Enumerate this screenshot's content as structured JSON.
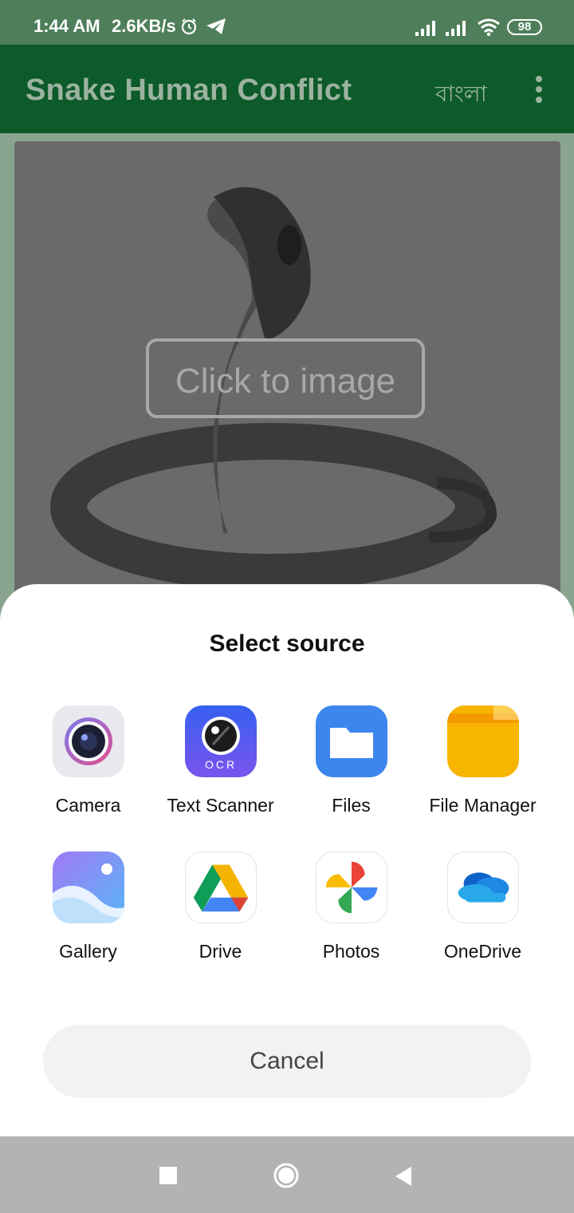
{
  "status_bar": {
    "time": "1:44 AM",
    "speed": "2.6KB/s",
    "battery": "98"
  },
  "app_bar": {
    "title": "Snake Human Conflict",
    "language_button": "বাংলা"
  },
  "main": {
    "image_prompt": "Click to image"
  },
  "sheet": {
    "title": "Select source",
    "apps": [
      {
        "label": "Camera",
        "icon": "camera-icon"
      },
      {
        "label": "Text Scanner",
        "icon": "ocr-scanner-icon"
      },
      {
        "label": "Files",
        "icon": "folder-icon"
      },
      {
        "label": "File Manager",
        "icon": "file-manager-icon"
      },
      {
        "label": "Gallery",
        "icon": "gallery-icon"
      },
      {
        "label": "Drive",
        "icon": "google-drive-icon"
      },
      {
        "label": "Photos",
        "icon": "google-photos-icon"
      },
      {
        "label": "OneDrive",
        "icon": "onedrive-icon"
      }
    ],
    "ocr_text": "OCR",
    "cancel_label": "Cancel"
  },
  "colors": {
    "status_bar": "#4e7f5a",
    "app_bar": "#0d5a2a",
    "sheet": "#ffffff",
    "nav_bar": "#b3b3b3"
  }
}
